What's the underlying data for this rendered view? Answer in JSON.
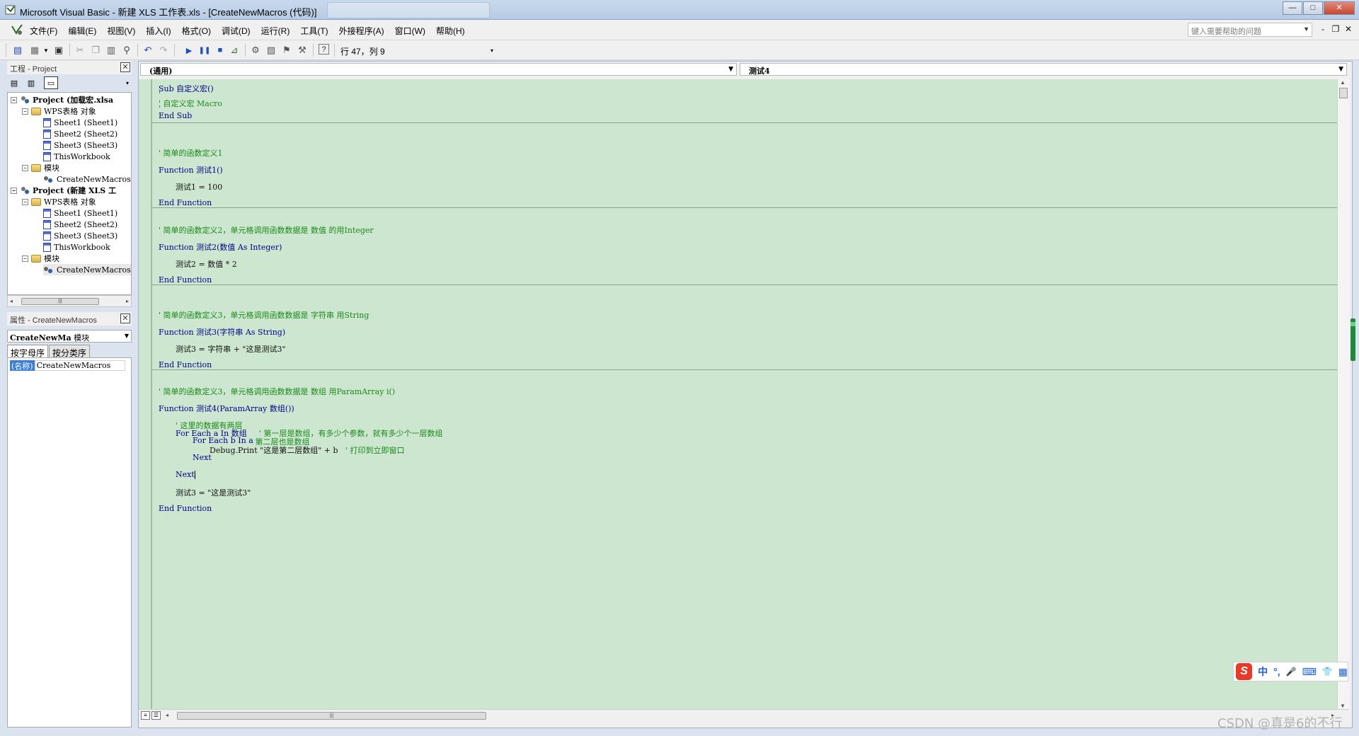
{
  "window": {
    "title": "Microsoft Visual Basic - 新建 XLS 工作表.xls - [CreateNewMacros (代码)]",
    "controls": [
      "—",
      "□",
      "✕"
    ]
  },
  "menubar": {
    "items": [
      "文件(F)",
      "编辑(E)",
      "视图(V)",
      "插入(I)",
      "格式(O)",
      "调试(D)",
      "运行(R)",
      "工具(T)",
      "外接程序(A)",
      "窗口(W)",
      "帮助(H)"
    ],
    "help_placeholder": "键入需要帮助的问题",
    "mdi_controls": [
      "-",
      "❐",
      "✕"
    ]
  },
  "toolbar": {
    "cursor_position": "行 47，列 9"
  },
  "project_panel": {
    "title": "工程 - Project",
    "close": "✕",
    "tree": [
      {
        "label": "Project (加载宏.xlsa",
        "bold": true,
        "level": 0,
        "icon": "project-icon",
        "expander": "−"
      },
      {
        "label": "WPS表格 对象",
        "level": 1,
        "icon": "folder-icon",
        "expander": "−"
      },
      {
        "label": "Sheet1 (Sheet1)",
        "level": 2,
        "icon": "sheet-icon"
      },
      {
        "label": "Sheet2 (Sheet2)",
        "level": 2,
        "icon": "sheet-icon"
      },
      {
        "label": "Sheet3 (Sheet3)",
        "level": 2,
        "icon": "sheet-icon"
      },
      {
        "label": "ThisWorkbook",
        "level": 2,
        "icon": "sheet-icon"
      },
      {
        "label": "模块",
        "level": 1,
        "icon": "folder-icon",
        "expander": "−"
      },
      {
        "label": "CreateNewMacros",
        "level": 2,
        "icon": "module-icon"
      },
      {
        "label": "Project (新建 XLS 工",
        "bold": true,
        "level": 0,
        "icon": "project-icon",
        "expander": "−"
      },
      {
        "label": "WPS表格 对象",
        "level": 1,
        "icon": "folder-icon",
        "expander": "−"
      },
      {
        "label": "Sheet1 (Sheet1)",
        "level": 2,
        "icon": "sheet-icon"
      },
      {
        "label": "Sheet2 (Sheet2)",
        "level": 2,
        "icon": "sheet-icon"
      },
      {
        "label": "Sheet3 (Sheet3)",
        "level": 2,
        "icon": "sheet-icon"
      },
      {
        "label": "ThisWorkbook",
        "level": 2,
        "icon": "sheet-icon"
      },
      {
        "label": "模块",
        "level": 1,
        "icon": "folder-icon",
        "expander": "−"
      },
      {
        "label": "CreateNewMacros",
        "level": 2,
        "icon": "module-icon"
      }
    ]
  },
  "properties_panel": {
    "title": "属性 - CreateNewMacros",
    "close": "✕",
    "object_name": "CreateNewMa",
    "object_type": "模块",
    "tabs": [
      "按字母序",
      "按分类序"
    ],
    "rows": [
      {
        "key": "(名称)",
        "value": "CreateNewMacros"
      }
    ]
  },
  "code_window": {
    "object_combo": "(通用)",
    "procedure_combo": "测试4",
    "lines": [
      {
        "text": "Sub 自定义宏()",
        "kind": "code"
      },
      {
        "text": "'",
        "kind": "comment"
      },
      {
        "text": "' 自定义宏 Macro",
        "kind": "comment"
      },
      {
        "text": "'",
        "kind": "comment"
      },
      {
        "text": "End Sub",
        "kind": "code"
      },
      {
        "text": "' 简单的函数定义1",
        "kind": "comment"
      },
      {
        "text": "Function 测试1()",
        "kind": "code"
      },
      {
        "text": "测试1 = 100",
        "kind": "code"
      },
      {
        "text": "End Function",
        "kind": "code"
      },
      {
        "text": "' 简单的函数定义2，单元格调用函数数据是 数值 的用Integer",
        "kind": "comment"
      },
      {
        "text": "Function 测试2(数值 As Integer)",
        "kind": "code"
      },
      {
        "text": "测试2 = 数值 * 2",
        "kind": "code"
      },
      {
        "text": "End Function",
        "kind": "code"
      },
      {
        "text": "' 简单的函数定义3，单元格调用函数数据是 字符串 用String",
        "kind": "comment"
      },
      {
        "text": "Function 测试3(字符串 As String)",
        "kind": "code"
      },
      {
        "text": "测试3 = 字符串 + \"这是测试3\"",
        "kind": "code"
      },
      {
        "text": "End Function",
        "kind": "code"
      },
      {
        "text": "' 简单的函数定义3，单元格调用函数数据是 数组 用ParamArray i()",
        "kind": "comment"
      },
      {
        "text": "Function 测试4(ParamArray 数组())",
        "kind": "code"
      },
      {
        "text": "' 这里的数据有两层",
        "kind": "comment"
      },
      {
        "text": "For Each a In 数组",
        "kind": "code"
      },
      {
        "text": "' 第一层是数组，有多少个参数，就有多少个一层数组",
        "kind": "comment"
      },
      {
        "text": "For Each b In a",
        "kind": "code"
      },
      {
        "text": "' 第二层也是数组",
        "kind": "comment"
      },
      {
        "text": "Debug.Print \"这是第二层数组\" + b",
        "kind": "code"
      },
      {
        "text": "' 打印到立即窗口",
        "kind": "comment"
      },
      {
        "text": "Next",
        "kind": "code"
      },
      {
        "text": "Next",
        "kind": "code"
      },
      {
        "text": "测试3 = \"这是测试3\"",
        "kind": "code"
      },
      {
        "text": "End Function",
        "kind": "code"
      }
    ]
  },
  "ime": {
    "logo": "S",
    "items": [
      "中",
      "°,",
      "🎤",
      "⌨",
      "👕",
      "▦"
    ]
  },
  "watermark": "CSDN @真是6的不行",
  "colors": {
    "code_bg": "#cde6cf",
    "comment": "#1a8a1a",
    "keyword": "#00008b",
    "accent": "#3c7fd4"
  }
}
